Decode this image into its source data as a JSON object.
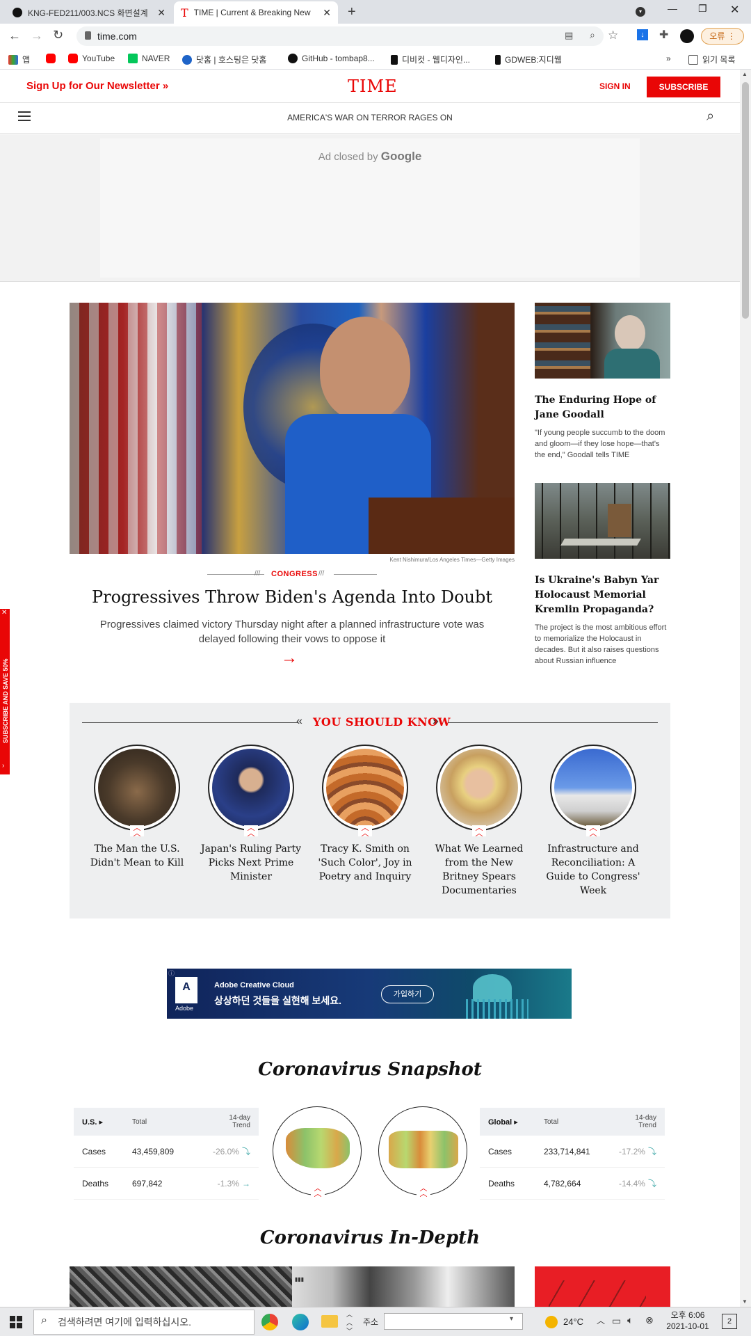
{
  "browser": {
    "tabs": [
      {
        "title": "KNG-FED211/003.NCS 화면설계"
      },
      {
        "title": "TIME | Current & Breaking New"
      }
    ],
    "url": "time.com",
    "error_button": "오류",
    "bookmarks": [
      "앱",
      "YouTube",
      "NAVER",
      "닷홈 | 호스팅은 닷홈",
      "GitHub - tombap8...",
      "디비컷 - 웹디자인...",
      "GDWEB:지디웹"
    ],
    "reading_list": "읽기 목록",
    "more": "»"
  },
  "site": {
    "newsletter": "Sign Up for Our Newsletter",
    "logo": "TIME",
    "sign_in": "SIGN IN",
    "subscribe": "SUBSCRIBE",
    "ticker": "AMERICA'S WAR ON TERROR RAGES ON",
    "ad_closed": "Ad closed by",
    "ad_google": "Google",
    "side_tab": "SUBSCRIBE AND SAVE 50%"
  },
  "hero": {
    "credit": "Kent Nishimura/Los Angeles Times—Getty Images",
    "section": "CONGRESS",
    "headline": "Progressives Throw Biden's Agenda Into Doubt",
    "summary": "Progressives claimed victory Thursday night after a planned infrastructure vote was delayed following their vows to oppose it",
    "arrow": "→"
  },
  "side_stories": [
    {
      "title": "The Enduring Hope of Jane Goodall",
      "desc": "\"If young people succumb to the doom and gloom—if they lose hope—that's the end,\" Goodall tells TIME"
    },
    {
      "title": "Is Ukraine's Babyn Yar Holocaust Memorial Kremlin Propaganda?",
      "desc": "The project is the most ambitious effort to memorialize the Holocaust in decades. But it also raises questions about Russian influence"
    }
  ],
  "you_should_know": {
    "heading": "YOU SHOULD KNOW",
    "items": [
      {
        "title": "The Man the U.S. Didn't Mean to Kill"
      },
      {
        "title": "Japan's Ruling Party Picks Next Prime Minister"
      },
      {
        "title": "Tracy K. Smith on 'Such Color', Joy in Poetry and Inquiry"
      },
      {
        "title": "What We Learned from the New Britney Spears Documentaries"
      },
      {
        "title": "Infrastructure and Reconciliation: A Guide to Congress' Week"
      }
    ]
  },
  "ad_banner": {
    "brand": "Adobe Creative Cloud",
    "text": "상상하던 것들을 실현해 보세요.",
    "cta": "가입하기",
    "logo": "Adobe"
  },
  "corona": {
    "snapshot_title": "Coronavirus Snapshot",
    "indepth_title": "Coronavirus In-Depth",
    "us": {
      "label": "U.S.",
      "total": "Total",
      "trend": "14-day Trend",
      "rows": [
        {
          "name": "Cases",
          "total": "43,459,809",
          "trend": "-26.0%"
        },
        {
          "name": "Deaths",
          "total": "697,842",
          "trend": "-1.3%"
        }
      ]
    },
    "global": {
      "label": "Global",
      "total": "Total",
      "trend": "14-day Trend",
      "rows": [
        {
          "name": "Cases",
          "total": "233,714,841",
          "trend": "-17.2%"
        },
        {
          "name": "Deaths",
          "total": "4,782,664",
          "trend": "-14.4%"
        }
      ]
    }
  },
  "taskbar": {
    "search": "검색하려면 여기에 입력하십시오.",
    "address_label": "주소",
    "weather": "24°C",
    "time": "오후 6:06",
    "date": "2021-10-01",
    "notif": "2"
  }
}
